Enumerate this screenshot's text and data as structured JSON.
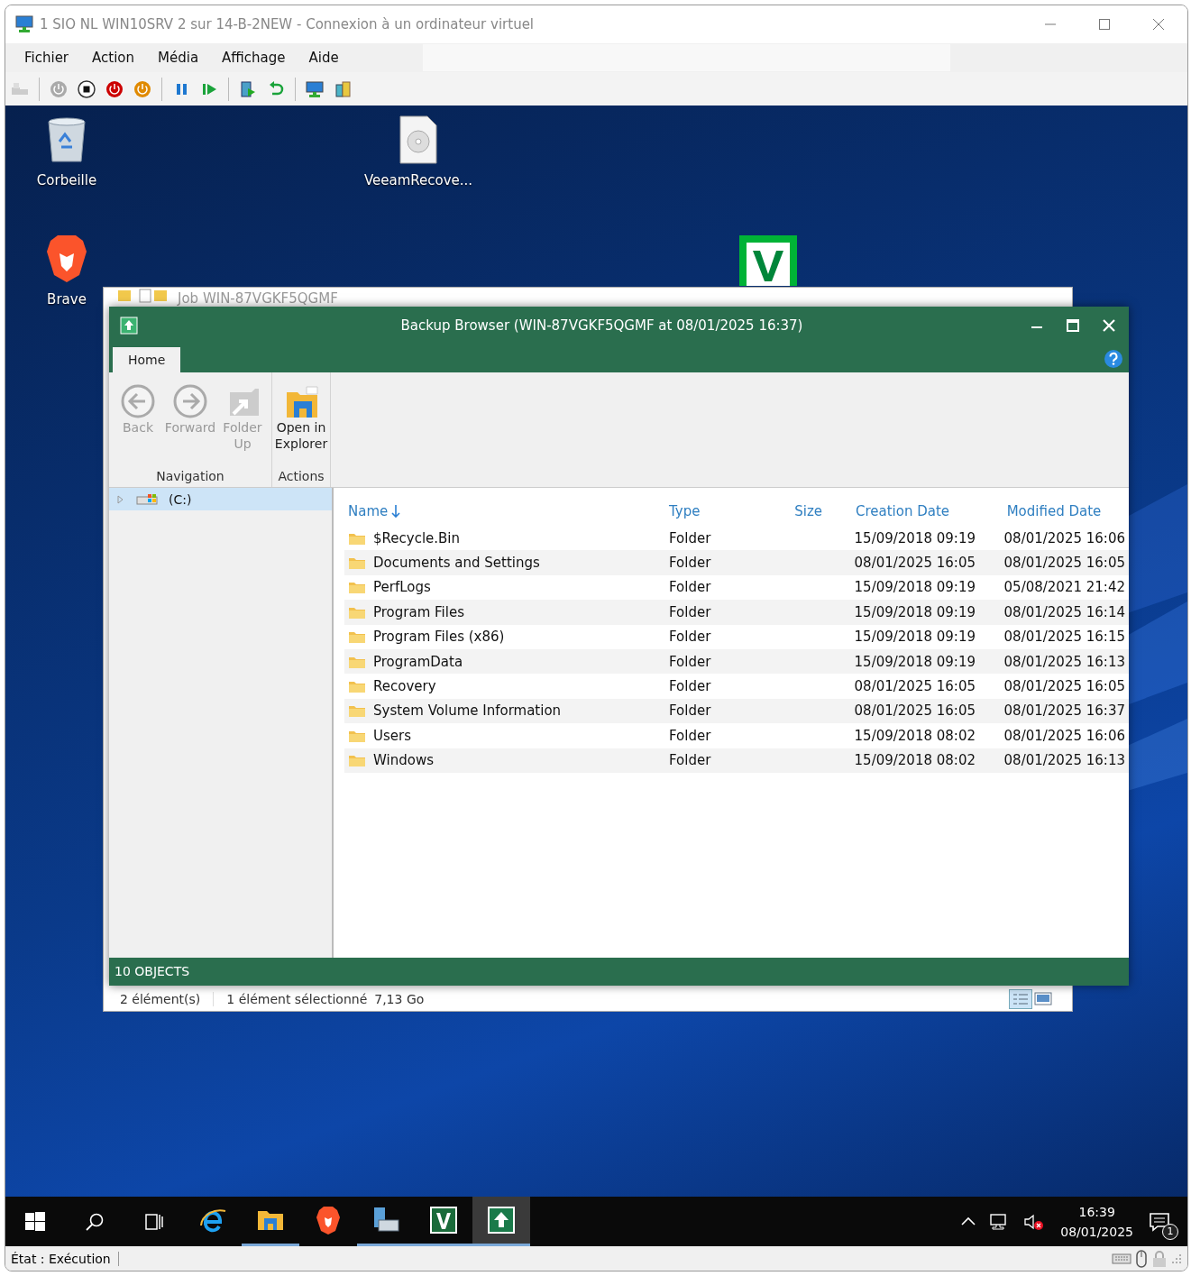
{
  "window": {
    "title": "1 SIO NL WIN10SRV 2 sur 14-B-2NEW - Connexion à un ordinateur virtuel"
  },
  "menu": [
    "Fichier",
    "Action",
    "Média",
    "Affichage",
    "Aide"
  ],
  "desktop": {
    "icons": [
      {
        "kind": "recycle",
        "label": "Corbeille"
      },
      {
        "kind": "disc",
        "label": "VeeamRecove..."
      },
      {
        "kind": "brave",
        "label": "Brave"
      },
      {
        "kind": "veeam"
      }
    ]
  },
  "explorer_window": {
    "title": "Job WIN-87VGKF5QGMF",
    "status": [
      "2 élément(s)",
      "1 élément sélectionné",
      "7,13 Go"
    ]
  },
  "backup_browser": {
    "title": "Backup Browser (WIN-87VGKF5QGMF at 08/01/2025 16:37)",
    "tabs": [
      {
        "label": "Home",
        "selected": true
      }
    ],
    "ribbon": [
      {
        "label": "Navigation",
        "buttons": [
          {
            "kind": "back",
            "label": "Back",
            "disabled": true
          },
          {
            "kind": "forward",
            "label": "Forward",
            "disabled": true
          },
          {
            "kind": "folder-up",
            "label": "Folder Up",
            "disabled": true
          }
        ]
      },
      {
        "label": "Actions",
        "buttons": [
          {
            "kind": "open-explorer",
            "label": "Open in Explorer",
            "disabled": false
          }
        ]
      }
    ],
    "tree": [
      {
        "label": "(C:)",
        "selected": true,
        "expanded": false
      }
    ],
    "columns": [
      {
        "label": "Name",
        "sorted": true
      },
      {
        "label": "Type",
        "sorted": false
      },
      {
        "label": "Size",
        "sorted": false
      },
      {
        "label": "Creation Date",
        "sorted": false
      },
      {
        "label": "Modified Date",
        "sorted": false
      }
    ],
    "rows": [
      {
        "name": "$Recycle.Bin",
        "type": "Folder",
        "created": "15/09/2018 09:19",
        "modified": "08/01/2025 16:06"
      },
      {
        "name": "Documents and Settings",
        "type": "Folder",
        "created": "08/01/2025 16:05",
        "modified": "08/01/2025 16:05"
      },
      {
        "name": "PerfLogs",
        "type": "Folder",
        "created": "15/09/2018 09:19",
        "modified": "05/08/2021 21:42"
      },
      {
        "name": "Program Files",
        "type": "Folder",
        "created": "15/09/2018 09:19",
        "modified": "08/01/2025 16:14"
      },
      {
        "name": "Program Files (x86)",
        "type": "Folder",
        "created": "15/09/2018 09:19",
        "modified": "08/01/2025 16:15"
      },
      {
        "name": "ProgramData",
        "type": "Folder",
        "created": "15/09/2018 09:19",
        "modified": "08/01/2025 16:13"
      },
      {
        "name": "Recovery",
        "type": "Folder",
        "created": "08/01/2025 16:05",
        "modified": "08/01/2025 16:05"
      },
      {
        "name": "System Volume Information",
        "type": "Folder",
        "created": "08/01/2025 16:05",
        "modified": "08/01/2025 16:37"
      },
      {
        "name": "Users",
        "type": "Folder",
        "created": "15/09/2018 08:02",
        "modified": "08/01/2025 16:06"
      },
      {
        "name": "Windows",
        "type": "Folder",
        "created": "15/09/2018 08:02",
        "modified": "08/01/2025 16:13"
      }
    ],
    "status": "10 OBJECTS"
  },
  "taskbar": {
    "items": [
      {
        "kind": "ie",
        "running": false,
        "active": false
      },
      {
        "kind": "explorer",
        "running": true,
        "active": false
      },
      {
        "kind": "brave",
        "running": false,
        "active": false
      },
      {
        "kind": "server",
        "running": true,
        "active": false
      },
      {
        "kind": "veeam",
        "running": true,
        "active": false
      },
      {
        "kind": "backup",
        "running": true,
        "active": true
      }
    ],
    "time": "16:39",
    "date": "08/01/2025",
    "notifications": "1"
  },
  "status_bar": {
    "state": "État : Exécution"
  }
}
